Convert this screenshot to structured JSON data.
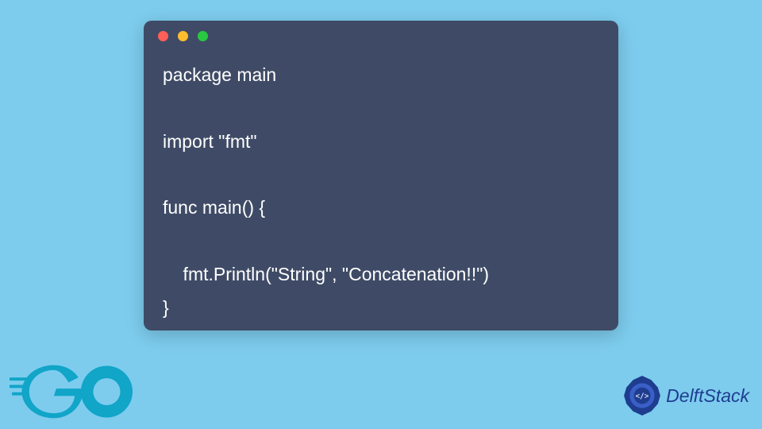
{
  "window": {
    "dots": [
      "red",
      "yellow",
      "green"
    ]
  },
  "code": {
    "lines": [
      "package main",
      "",
      "import \"fmt\"",
      "",
      "func main() {",
      "",
      "    fmt.Println(\"String\", \"Concatenation!!\")",
      "}"
    ]
  },
  "logos": {
    "go_text": "GO",
    "delft_text": "DelftStack",
    "delft_badge": "</>"
  },
  "colors": {
    "page_bg": "#7dccee",
    "window_bg": "#3f4b66",
    "code_fg": "#ffffff",
    "go_fg": "#11A5C8",
    "delft_fg": "#1f3d8f"
  }
}
